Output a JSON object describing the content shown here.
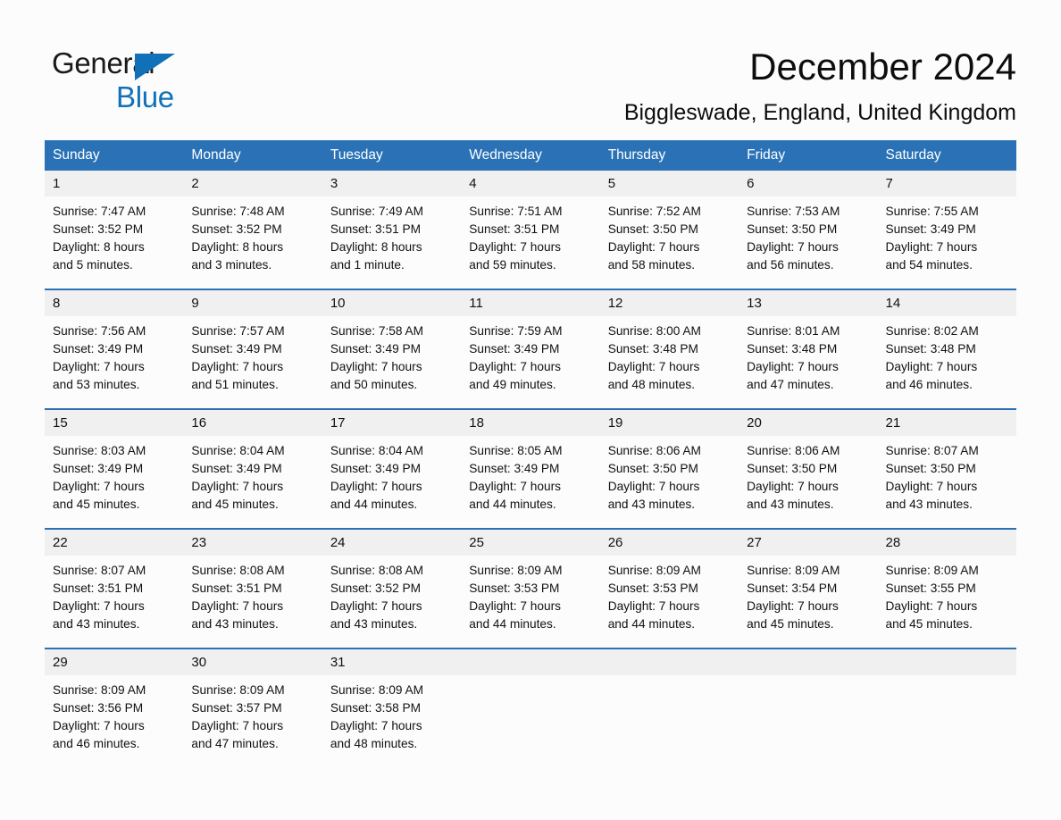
{
  "brand": {
    "name_part1": "General",
    "name_part2": "Blue",
    "triangle_color": "#1071b8"
  },
  "header": {
    "month_title": "December 2024",
    "location": "Biggleswade, England, United Kingdom"
  },
  "theme": {
    "header_blue": "#2a72b5",
    "daynum_band": "#f0f0f0",
    "page_background": "#fcfcfc",
    "text_color": "#111111"
  },
  "calendar": {
    "weekday_headers": [
      "Sunday",
      "Monday",
      "Tuesday",
      "Wednesday",
      "Thursday",
      "Friday",
      "Saturday"
    ],
    "weeks": [
      [
        {
          "day": "1",
          "sunrise": "Sunrise: 7:47 AM",
          "sunset": "Sunset: 3:52 PM",
          "daylight1": "Daylight: 8 hours",
          "daylight2": "and 5 minutes."
        },
        {
          "day": "2",
          "sunrise": "Sunrise: 7:48 AM",
          "sunset": "Sunset: 3:52 PM",
          "daylight1": "Daylight: 8 hours",
          "daylight2": "and 3 minutes."
        },
        {
          "day": "3",
          "sunrise": "Sunrise: 7:49 AM",
          "sunset": "Sunset: 3:51 PM",
          "daylight1": "Daylight: 8 hours",
          "daylight2": "and 1 minute."
        },
        {
          "day": "4",
          "sunrise": "Sunrise: 7:51 AM",
          "sunset": "Sunset: 3:51 PM",
          "daylight1": "Daylight: 7 hours",
          "daylight2": "and 59 minutes."
        },
        {
          "day": "5",
          "sunrise": "Sunrise: 7:52 AM",
          "sunset": "Sunset: 3:50 PM",
          "daylight1": "Daylight: 7 hours",
          "daylight2": "and 58 minutes."
        },
        {
          "day": "6",
          "sunrise": "Sunrise: 7:53 AM",
          "sunset": "Sunset: 3:50 PM",
          "daylight1": "Daylight: 7 hours",
          "daylight2": "and 56 minutes."
        },
        {
          "day": "7",
          "sunrise": "Sunrise: 7:55 AM",
          "sunset": "Sunset: 3:49 PM",
          "daylight1": "Daylight: 7 hours",
          "daylight2": "and 54 minutes."
        }
      ],
      [
        {
          "day": "8",
          "sunrise": "Sunrise: 7:56 AM",
          "sunset": "Sunset: 3:49 PM",
          "daylight1": "Daylight: 7 hours",
          "daylight2": "and 53 minutes."
        },
        {
          "day": "9",
          "sunrise": "Sunrise: 7:57 AM",
          "sunset": "Sunset: 3:49 PM",
          "daylight1": "Daylight: 7 hours",
          "daylight2": "and 51 minutes."
        },
        {
          "day": "10",
          "sunrise": "Sunrise: 7:58 AM",
          "sunset": "Sunset: 3:49 PM",
          "daylight1": "Daylight: 7 hours",
          "daylight2": "and 50 minutes."
        },
        {
          "day": "11",
          "sunrise": "Sunrise: 7:59 AM",
          "sunset": "Sunset: 3:49 PM",
          "daylight1": "Daylight: 7 hours",
          "daylight2": "and 49 minutes."
        },
        {
          "day": "12",
          "sunrise": "Sunrise: 8:00 AM",
          "sunset": "Sunset: 3:48 PM",
          "daylight1": "Daylight: 7 hours",
          "daylight2": "and 48 minutes."
        },
        {
          "day": "13",
          "sunrise": "Sunrise: 8:01 AM",
          "sunset": "Sunset: 3:48 PM",
          "daylight1": "Daylight: 7 hours",
          "daylight2": "and 47 minutes."
        },
        {
          "day": "14",
          "sunrise": "Sunrise: 8:02 AM",
          "sunset": "Sunset: 3:48 PM",
          "daylight1": "Daylight: 7 hours",
          "daylight2": "and 46 minutes."
        }
      ],
      [
        {
          "day": "15",
          "sunrise": "Sunrise: 8:03 AM",
          "sunset": "Sunset: 3:49 PM",
          "daylight1": "Daylight: 7 hours",
          "daylight2": "and 45 minutes."
        },
        {
          "day": "16",
          "sunrise": "Sunrise: 8:04 AM",
          "sunset": "Sunset: 3:49 PM",
          "daylight1": "Daylight: 7 hours",
          "daylight2": "and 45 minutes."
        },
        {
          "day": "17",
          "sunrise": "Sunrise: 8:04 AM",
          "sunset": "Sunset: 3:49 PM",
          "daylight1": "Daylight: 7 hours",
          "daylight2": "and 44 minutes."
        },
        {
          "day": "18",
          "sunrise": "Sunrise: 8:05 AM",
          "sunset": "Sunset: 3:49 PM",
          "daylight1": "Daylight: 7 hours",
          "daylight2": "and 44 minutes."
        },
        {
          "day": "19",
          "sunrise": "Sunrise: 8:06 AM",
          "sunset": "Sunset: 3:50 PM",
          "daylight1": "Daylight: 7 hours",
          "daylight2": "and 43 minutes."
        },
        {
          "day": "20",
          "sunrise": "Sunrise: 8:06 AM",
          "sunset": "Sunset: 3:50 PM",
          "daylight1": "Daylight: 7 hours",
          "daylight2": "and 43 minutes."
        },
        {
          "day": "21",
          "sunrise": "Sunrise: 8:07 AM",
          "sunset": "Sunset: 3:50 PM",
          "daylight1": "Daylight: 7 hours",
          "daylight2": "and 43 minutes."
        }
      ],
      [
        {
          "day": "22",
          "sunrise": "Sunrise: 8:07 AM",
          "sunset": "Sunset: 3:51 PM",
          "daylight1": "Daylight: 7 hours",
          "daylight2": "and 43 minutes."
        },
        {
          "day": "23",
          "sunrise": "Sunrise: 8:08 AM",
          "sunset": "Sunset: 3:51 PM",
          "daylight1": "Daylight: 7 hours",
          "daylight2": "and 43 minutes."
        },
        {
          "day": "24",
          "sunrise": "Sunrise: 8:08 AM",
          "sunset": "Sunset: 3:52 PM",
          "daylight1": "Daylight: 7 hours",
          "daylight2": "and 43 minutes."
        },
        {
          "day": "25",
          "sunrise": "Sunrise: 8:09 AM",
          "sunset": "Sunset: 3:53 PM",
          "daylight1": "Daylight: 7 hours",
          "daylight2": "and 44 minutes."
        },
        {
          "day": "26",
          "sunrise": "Sunrise: 8:09 AM",
          "sunset": "Sunset: 3:53 PM",
          "daylight1": "Daylight: 7 hours",
          "daylight2": "and 44 minutes."
        },
        {
          "day": "27",
          "sunrise": "Sunrise: 8:09 AM",
          "sunset": "Sunset: 3:54 PM",
          "daylight1": "Daylight: 7 hours",
          "daylight2": "and 45 minutes."
        },
        {
          "day": "28",
          "sunrise": "Sunrise: 8:09 AM",
          "sunset": "Sunset: 3:55 PM",
          "daylight1": "Daylight: 7 hours",
          "daylight2": "and 45 minutes."
        }
      ],
      [
        {
          "day": "29",
          "sunrise": "Sunrise: 8:09 AM",
          "sunset": "Sunset: 3:56 PM",
          "daylight1": "Daylight: 7 hours",
          "daylight2": "and 46 minutes."
        },
        {
          "day": "30",
          "sunrise": "Sunrise: 8:09 AM",
          "sunset": "Sunset: 3:57 PM",
          "daylight1": "Daylight: 7 hours",
          "daylight2": "and 47 minutes."
        },
        {
          "day": "31",
          "sunrise": "Sunrise: 8:09 AM",
          "sunset": "Sunset: 3:58 PM",
          "daylight1": "Daylight: 7 hours",
          "daylight2": "and 48 minutes."
        },
        {
          "day": "",
          "sunrise": "",
          "sunset": "",
          "daylight1": "",
          "daylight2": ""
        },
        {
          "day": "",
          "sunrise": "",
          "sunset": "",
          "daylight1": "",
          "daylight2": ""
        },
        {
          "day": "",
          "sunrise": "",
          "sunset": "",
          "daylight1": "",
          "daylight2": ""
        },
        {
          "day": "",
          "sunrise": "",
          "sunset": "",
          "daylight1": "",
          "daylight2": ""
        }
      ]
    ]
  }
}
